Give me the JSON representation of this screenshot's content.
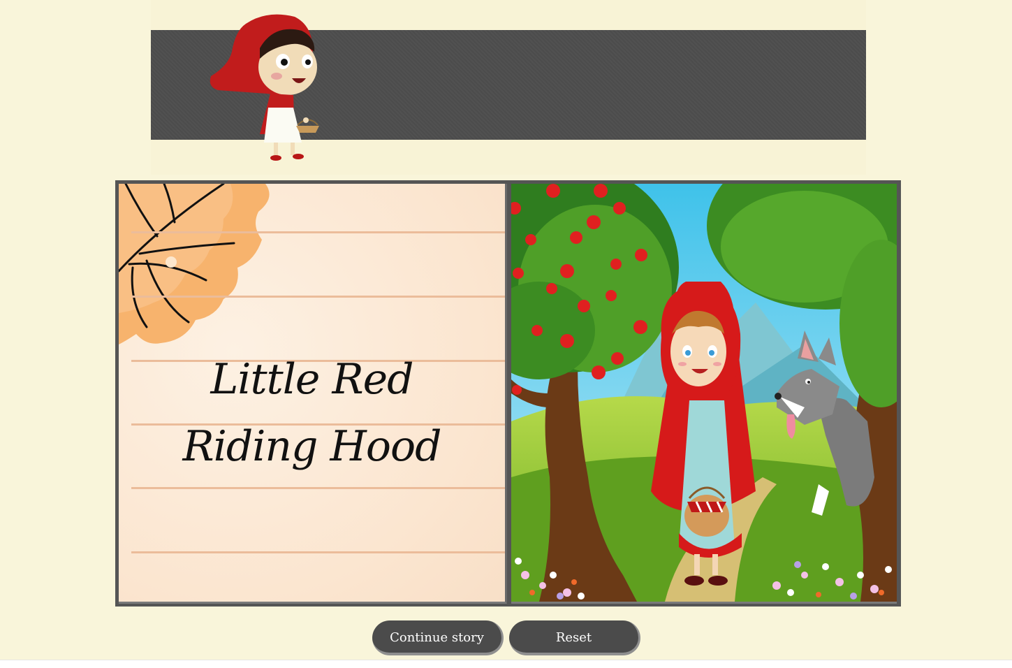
{
  "story": {
    "title_line1": "Little Red",
    "title_line2": "Riding Hood"
  },
  "controls": {
    "continue_label": "Continue story",
    "reset_label": "Reset"
  },
  "colors": {
    "background": "#f9f5da",
    "banner": "#4e4e4e",
    "button": "#4b4b4b",
    "paper": "#fbe9d7",
    "hood_red": "#d21e1e"
  },
  "icons": {
    "mascot": "little-red-riding-hood-mascot",
    "leaf": "orange-leaf-decoration",
    "illustration": "forest-scene-with-wolf"
  }
}
